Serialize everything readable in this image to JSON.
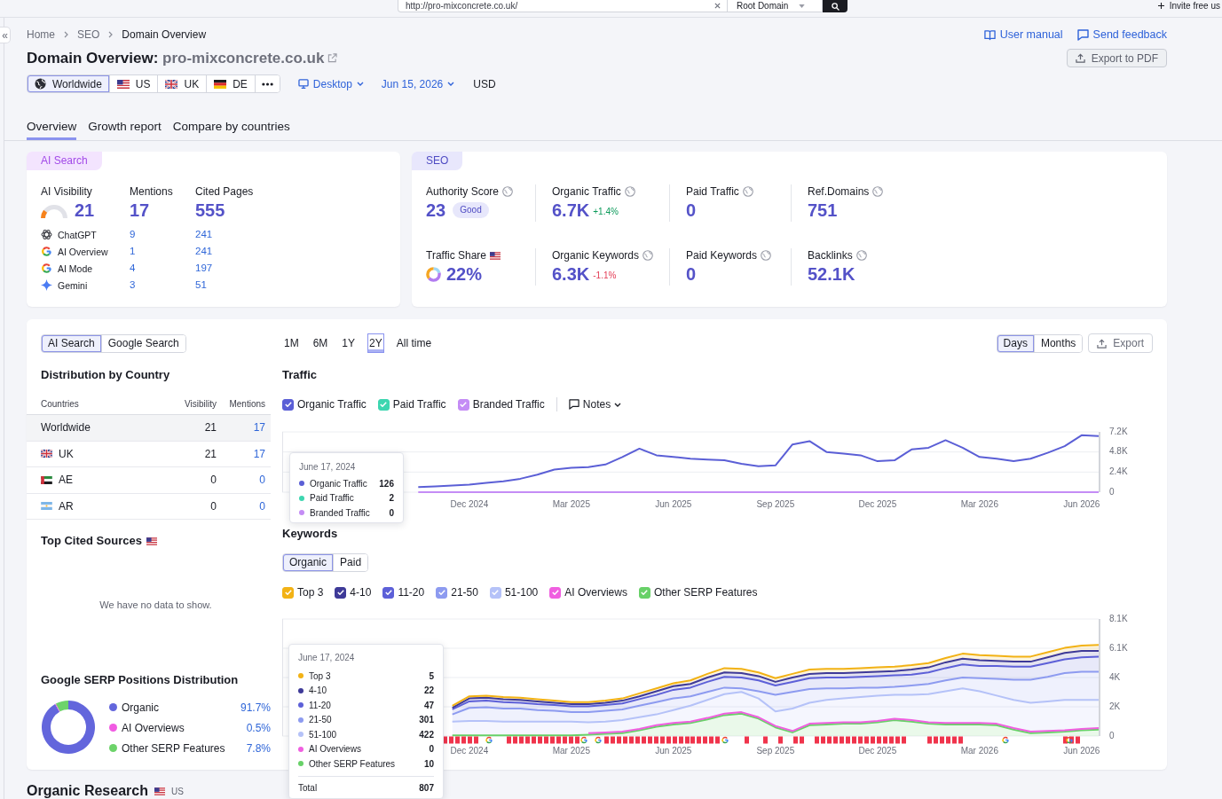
{
  "top_bar": {
    "search": {
      "value": "http://pro-mixconcrete.co.uk/"
    },
    "scope": "Root Domain",
    "invite": "Invite free us"
  },
  "sidebar_toggle": "«",
  "breadcrumbs": [
    "Home",
    "SEO",
    "Domain Overview"
  ],
  "help_links": [
    {
      "kind": "manual",
      "label": "User manual"
    },
    {
      "kind": "feedback",
      "label": "Send feedback"
    }
  ],
  "title": {
    "prefix": "Domain Overview:",
    "domain": "pro-mixconcrete.co.uk"
  },
  "export_button": "Export to PDF",
  "locations": [
    {
      "label": "Worldwide",
      "flag": {
        "kind": "world"
      },
      "selected": true
    },
    {
      "label": "US",
      "flag": {
        "kind": "us"
      },
      "selected": false
    },
    {
      "label": "UK",
      "flag": {
        "kind": "gb"
      },
      "selected": false
    },
    {
      "label": "DE",
      "flag": {
        "kind": "de"
      },
      "selected": false
    }
  ],
  "device": "Desktop",
  "date": "Jun 15, 2026",
  "currency": "USD",
  "tabs": [
    {
      "label": "Overview",
      "selected": true
    },
    {
      "label": "Growth report",
      "selected": false
    },
    {
      "label": "Compare by countries",
      "selected": false
    }
  ],
  "ai_search": {
    "tag": "AI Search",
    "columns": [
      {
        "label": "AI Visibility",
        "value": "21",
        "level": 0.21
      },
      {
        "label": "Mentions",
        "value": "17"
      },
      {
        "label": "Cited Pages",
        "value": "555"
      }
    ],
    "platforms": [
      {
        "name": "ChatGPT",
        "kind": "chatgpt",
        "mentions": "9",
        "cited": "241"
      },
      {
        "name": "AI Overview",
        "kind": "google",
        "mentions": "1",
        "cited": "241"
      },
      {
        "name": "AI Mode",
        "kind": "google",
        "mentions": "4",
        "cited": "197"
      },
      {
        "name": "Gemini",
        "kind": "gemini",
        "mentions": "3",
        "cited": "51"
      }
    ]
  },
  "seo": {
    "tag": "SEO",
    "metrics": [
      {
        "label": "Authority Score",
        "kind": "score",
        "value": "23",
        "badge": "Good"
      },
      {
        "label": "Organic Traffic",
        "kind": "delta",
        "value": "6.7K",
        "change": "+1.4%",
        "positive": true
      },
      {
        "label": "Paid Traffic",
        "kind": "plain",
        "value": "0"
      },
      {
        "label": "Ref.Domains",
        "kind": "plain",
        "value": "751"
      },
      {
        "label": "Traffic Share",
        "kind": "share",
        "flag": {
          "kind": "us"
        },
        "value": "22%"
      },
      {
        "label": "Organic Keywords",
        "kind": "delta",
        "value": "6.3K",
        "change": "-1.1%",
        "positive": false
      },
      {
        "label": "Paid Keywords",
        "kind": "plain",
        "value": "0"
      },
      {
        "label": "Backlinks",
        "kind": "plain",
        "value": "52.1K"
      }
    ]
  },
  "panel": {
    "source_toggle": [
      {
        "label": "AI Search",
        "selected": true
      },
      {
        "label": "Google Search",
        "selected": false
      }
    ],
    "distribution": {
      "title": "Distribution by Country",
      "columns": [
        "Countries",
        "Visibility",
        "Mentions"
      ],
      "rows": [
        {
          "country": "Worldwide",
          "visibility": "21",
          "mentions": "17",
          "selected": true
        },
        {
          "country": "UK",
          "flag": {
            "kind": "gb"
          },
          "visibility": "21",
          "mentions": "17",
          "selected": false
        },
        {
          "country": "AE",
          "flag": {
            "kind": "ae"
          },
          "visibility": "0",
          "mentions": "0",
          "selected": false
        },
        {
          "country": "AR",
          "flag": {
            "kind": "ar"
          },
          "visibility": "0",
          "mentions": "0",
          "selected": false
        }
      ]
    },
    "top_cited": {
      "title": "Top Cited Sources",
      "flag": {
        "kind": "us"
      },
      "empty": "We have no data to show."
    },
    "serp_distribution": {
      "title": "Google SERP Positions Distribution",
      "chart_data": {
        "type": "donut",
        "categories": [
          "Organic",
          "AI Overviews",
          "Other SERP Features"
        ],
        "values": [
          91.7,
          0.5,
          7.8
        ]
      },
      "legend": [
        {
          "share": "91.7%",
          "color": "#6366dc"
        },
        {
          "share": "0.5%",
          "color": "#f15be2"
        },
        {
          "share": "7.8%",
          "color": "#6dd36a"
        }
      ]
    },
    "ranges": [
      {
        "label": "1M",
        "selected": false
      },
      {
        "label": "6M",
        "selected": false
      },
      {
        "label": "1Y",
        "selected": false
      },
      {
        "label": "2Y",
        "selected": true
      },
      {
        "label": "All time",
        "selected": false
      }
    ],
    "granularity": [
      {
        "label": "Days",
        "selected": true
      },
      {
        "label": "Months",
        "selected": false
      }
    ],
    "export": "Export",
    "traffic": {
      "title": "Traffic",
      "legend": [
        {
          "label": "Organic Traffic",
          "checked": true
        },
        {
          "label": "Paid Traffic",
          "checked": true
        },
        {
          "label": "Branded Traffic",
          "checked": true
        }
      ],
      "notes": "Notes",
      "chart_data": {
        "type": "line",
        "grid": true,
        "categories": [
          null,
          null,
          null,
          null,
          null,
          null,
          null,
          null,
          null,
          null,
          null,
          "Dec 2024",
          null,
          null,
          null,
          null,
          null,
          "Mar 2025",
          null,
          null,
          null,
          null,
          null,
          "Jun 2025",
          null,
          null,
          null,
          null,
          null,
          "Sep 2025",
          null,
          null,
          null,
          null,
          null,
          "Dec 2025",
          null,
          null,
          null,
          null,
          null,
          "Mar 2026",
          null,
          null,
          null,
          null,
          null,
          "Jun 2026",
          null
        ],
        "ylim": [
          0,
          7200
        ],
        "yticks": [
          {
            "value": 0,
            "label": "0"
          },
          {
            "value": 2400,
            "label": "2.4K"
          },
          {
            "value": 4800,
            "label": "4.8K"
          },
          {
            "value": 7200,
            "label": "7.2K"
          }
        ],
        "series": [
          {
            "name": "Organic Traffic",
            "color": "#5b5fd6",
            "values": [
              null,
              null,
              null,
              null,
              null,
              null,
              null,
              null,
              600,
              700,
              800,
              900,
              1100,
              1300,
              1600,
              2100,
              2700,
              2900,
              3000,
              3300,
              4200,
              5200,
              4400,
              4200,
              4000,
              3900,
              3800,
              3400,
              3100,
              3200,
              5700,
              6100,
              4800,
              4600,
              4400,
              3700,
              3800,
              5100,
              5300,
              6200,
              5300,
              4200,
              4000,
              3700,
              4000,
              4700,
              5500,
              6800,
              6700
            ]
          },
          {
            "name": "Paid Traffic",
            "color": "#3dd6b0",
            "values": [
              null,
              null,
              null,
              null,
              null,
              null,
              null,
              null,
              null,
              null,
              null,
              null,
              null,
              null,
              null,
              null,
              null,
              null,
              null,
              null,
              null,
              null,
              null,
              null,
              null,
              null,
              null,
              null,
              null,
              null,
              null,
              null,
              null,
              null,
              null,
              null,
              null,
              null,
              null,
              null,
              null,
              null,
              null,
              null,
              null,
              null,
              null,
              null,
              null
            ]
          },
          {
            "name": "Branded Traffic",
            "color": "#c48cf5",
            "values": [
              null,
              null,
              null,
              null,
              null,
              null,
              null,
              null,
              0,
              0,
              0,
              0,
              0,
              0,
              0,
              0,
              0,
              0,
              0,
              0,
              0,
              0,
              0,
              0,
              0,
              0,
              0,
              0,
              0,
              0,
              0,
              0,
              0,
              0,
              0,
              0,
              0,
              0,
              0,
              0,
              0,
              0,
              0,
              0,
              0,
              0,
              0,
              0,
              0
            ]
          }
        ]
      },
      "tooltip": {
        "date": "June 17, 2024",
        "values": [
          "126",
          "2",
          "0"
        ]
      }
    },
    "keywords": {
      "title": "Keywords",
      "types": [
        {
          "label": "Organic",
          "selected": true
        },
        {
          "label": "Paid",
          "selected": false
        }
      ],
      "legend": [
        {
          "label": "Top 3",
          "checked": true
        },
        {
          "label": "4-10",
          "checked": true
        },
        {
          "label": "11-20",
          "checked": true
        },
        {
          "label": "21-50",
          "checked": true
        },
        {
          "label": "51-100",
          "checked": true
        },
        {
          "label": "AI Overviews",
          "checked": true
        },
        {
          "label": "Other SERP Features",
          "checked": true
        }
      ],
      "chart_data": {
        "type": "area",
        "grid": true,
        "categories": [
          null,
          null,
          null,
          null,
          null,
          null,
          null,
          null,
          null,
          null,
          null,
          "Dec 2024",
          null,
          null,
          null,
          null,
          null,
          "Mar 2025",
          null,
          null,
          null,
          null,
          null,
          "Jun 2025",
          null,
          null,
          null,
          null,
          null,
          "Sep 2025",
          null,
          null,
          null,
          null,
          null,
          "Dec 2025",
          null,
          null,
          null,
          null,
          null,
          "Mar 2026",
          null,
          null,
          null,
          null,
          null,
          "Jun 2026",
          null
        ],
        "ylim": [
          0,
          8100
        ],
        "yticks": [
          {
            "value": 0,
            "label": "0"
          },
          {
            "value": 2025,
            "label": "2K"
          },
          {
            "value": 4050,
            "label": "4K"
          },
          {
            "value": 6075,
            "label": "6.1K"
          },
          {
            "value": 8100,
            "label": "8.1K"
          }
        ],
        "series": [
          {
            "name": "Top 3",
            "color": "#f2b215",
            "values": [
              null,
              null,
              null,
              null,
              null,
              null,
              null,
              null,
              null,
              null,
              2100,
              2750,
              2800,
              2700,
              2650,
              2550,
              2450,
              2350,
              2350,
              2450,
              2600,
              2950,
              3300,
              3650,
              3850,
              4300,
              4700,
              4650,
              4400,
              4000,
              4300,
              4600,
              4650,
              4650,
              4700,
              4750,
              4800,
              4900,
              5050,
              5400,
              5700,
              5600,
              5550,
              5500,
              5500,
              5800,
              6100,
              6250,
              6300
            ]
          },
          {
            "name": "4-10",
            "color": "#3e3a98",
            "values": [
              null,
              null,
              null,
              null,
              null,
              null,
              null,
              null,
              null,
              null,
              1950,
              2600,
              2650,
              2550,
              2500,
              2400,
              2300,
              2200,
              2200,
              2300,
              2450,
              2750,
              3100,
              3450,
              3600,
              4050,
              4400,
              4350,
              4150,
              3750,
              4050,
              4300,
              4350,
              4350,
              4400,
              4450,
              4500,
              4600,
              4750,
              5100,
              5350,
              5250,
              5200,
              5150,
              5150,
              5450,
              5750,
              5900,
              5900
            ]
          },
          {
            "name": "11-20",
            "color": "#5d60d8",
            "values": [
              null,
              null,
              null,
              null,
              null,
              null,
              null,
              null,
              null,
              null,
              1850,
              2400,
              2450,
              2350,
              2300,
              2200,
              2150,
              2050,
              2050,
              2150,
              2250,
              2550,
              2850,
              3200,
              3350,
              3750,
              4100,
              4050,
              3850,
              3500,
              3750,
              4000,
              4050,
              4050,
              4100,
              4150,
              4200,
              4250,
              4400,
              4700,
              4950,
              4850,
              4850,
              4800,
              4800,
              5050,
              5300,
              5450,
              5500
            ]
          },
          {
            "name": "21-50",
            "color": "#8d9bf0",
            "values": [
              null,
              null,
              null,
              null,
              null,
              null,
              null,
              null,
              null,
              null,
              1500,
              1950,
              2000,
              1900,
              1900,
              1800,
              1750,
              1650,
              1650,
              1750,
              1850,
              2100,
              2350,
              2600,
              2750,
              3050,
              3350,
              3300,
              3100,
              2850,
              3050,
              3250,
              3300,
              3300,
              3350,
              3350,
              3400,
              3500,
              3600,
              3850,
              4050,
              4000,
              3950,
              3900,
              3900,
              4100,
              4350,
              4450,
              4450
            ]
          },
          {
            "name": "51-100",
            "color": "#b5c2f8",
            "values": [
              null,
              null,
              null,
              null,
              null,
              null,
              null,
              null,
              null,
              null,
              1000,
              1050,
              1050,
              1000,
              1000,
              1000,
              1000,
              1000,
              950,
              1000,
              1100,
              1300,
              1500,
              1800,
              2100,
              2500,
              2900,
              3050,
              2600,
              1700,
              1900,
              2300,
              2500,
              2600,
              2700,
              2800,
              2850,
              2850,
              2900,
              3100,
              3300,
              3100,
              2800,
              2500,
              2300,
              2400,
              2500,
              2500,
              2500
            ]
          },
          {
            "name": "AI Overviews",
            "color": "#f05fe0",
            "values": [
              null,
              null,
              null,
              null,
              null,
              null,
              null,
              null,
              null,
              null,
              null,
              null,
              null,
              null,
              null,
              null,
              null,
              null,
              200,
              250,
              300,
              500,
              750,
              900,
              1000,
              1250,
              1550,
              1650,
              1300,
              700,
              350,
              850,
              900,
              950,
              950,
              1050,
              1200,
              1100,
              950,
              900,
              900,
              900,
              850,
              550,
              300,
              350,
              400,
              500,
              550
            ]
          },
          {
            "name": "Other SERP Features",
            "color": "#68d168",
            "values": [
              null,
              null,
              null,
              null,
              null,
              null,
              null,
              null,
              null,
              null,
              50,
              50,
              50,
              50,
              50,
              50,
              50,
              50,
              100,
              150,
              200,
              400,
              650,
              800,
              900,
              1150,
              1450,
              1550,
              1200,
              600,
              250,
              750,
              800,
              850,
              850,
              950,
              1100,
              1000,
              850,
              800,
              800,
              800,
              750,
              450,
              200,
              250,
              300,
              400,
              450
            ]
          }
        ]
      },
      "tooltip": {
        "date": "June 17, 2024",
        "values": [
          "5",
          "22",
          "47",
          "301",
          "422",
          "0",
          "10"
        ],
        "total_label": "Total",
        "total": "807"
      }
    }
  },
  "organic_research": {
    "title": "Organic Research",
    "flag": {
      "kind": "us"
    },
    "database": "US"
  }
}
